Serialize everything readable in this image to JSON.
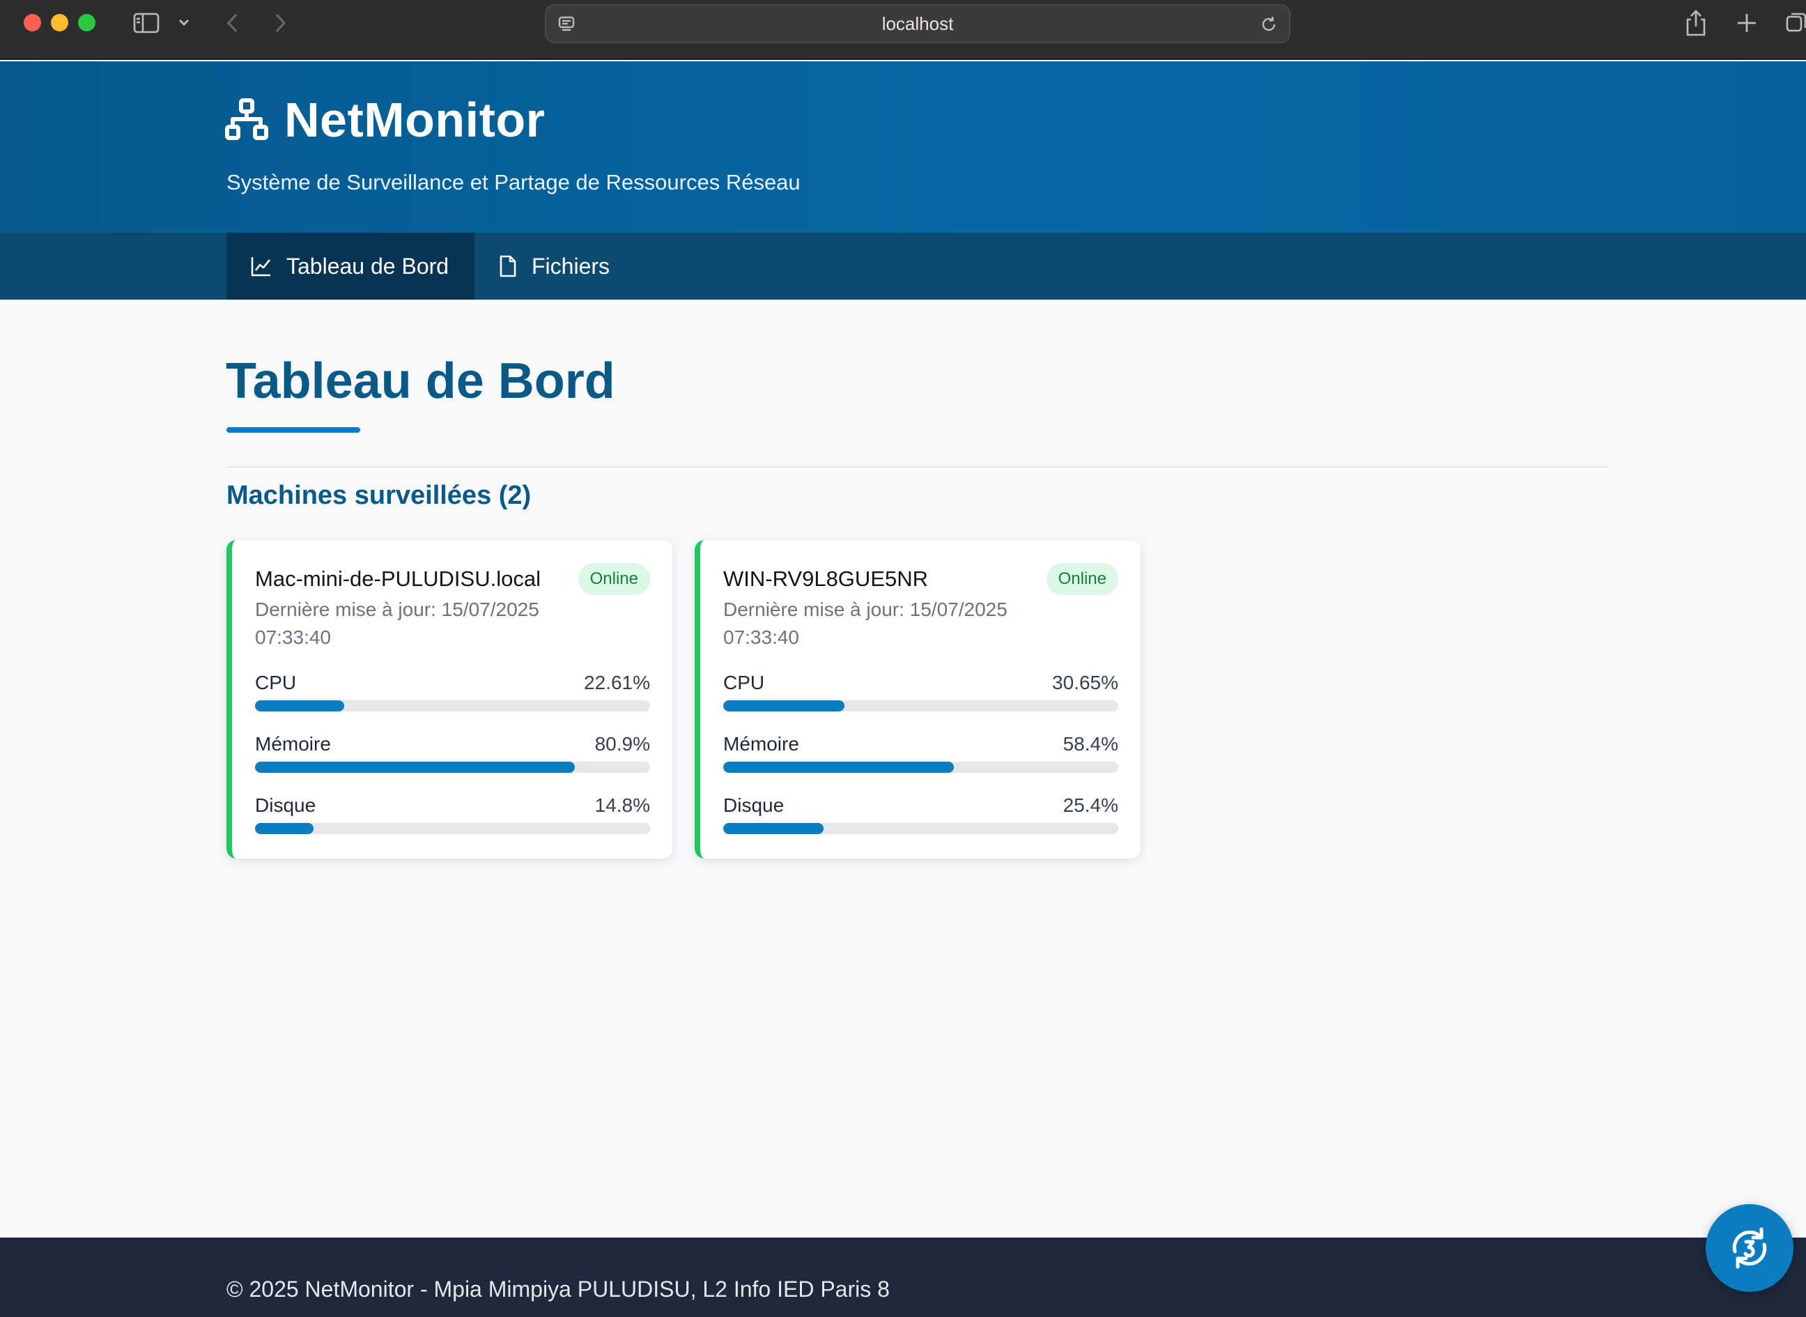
{
  "browser": {
    "url": "localhost"
  },
  "header": {
    "title": "NetMonitor",
    "subtitle": "Système de Surveillance et Partage de Ressources Réseau",
    "icon": "network-icon"
  },
  "nav": {
    "tabs": [
      {
        "label": "Tableau de Bord",
        "icon": "chart-line-icon",
        "active": true
      },
      {
        "label": "Fichiers",
        "icon": "file-icon",
        "active": false
      }
    ]
  },
  "main": {
    "title": "Tableau de Bord",
    "section_title": "Machines surveillées (2)",
    "machines": [
      {
        "name": "Mac-mini-de-PULUDISU.local",
        "status": "Online",
        "updated": "Dernière mise à jour: 15/07/2025 07:33:40",
        "metrics": [
          {
            "label": "CPU",
            "value": "22.61%",
            "percent": 22.61
          },
          {
            "label": "Mémoire",
            "value": "80.9%",
            "percent": 80.9
          },
          {
            "label": "Disque",
            "value": "14.8%",
            "percent": 14.8
          }
        ]
      },
      {
        "name": "WIN-RV9L8GUE5NR",
        "status": "Online",
        "updated": "Dernière mise à jour: 15/07/2025 07:33:40",
        "metrics": [
          {
            "label": "CPU",
            "value": "30.65%",
            "percent": 30.65
          },
          {
            "label": "Mémoire",
            "value": "58.4%",
            "percent": 58.4
          },
          {
            "label": "Disque",
            "value": "25.4%",
            "percent": 25.4
          }
        ]
      }
    ]
  },
  "footer": {
    "text": "© 2025 NetMonitor - Mpia Mimpiya PULUDISU, L2 Info IED Paris 8"
  },
  "colors": {
    "accent": "#0b7cc0",
    "header": "#0668a3",
    "nav": "#0c4a70",
    "online": "#22c55e",
    "footer": "#1e293b"
  }
}
